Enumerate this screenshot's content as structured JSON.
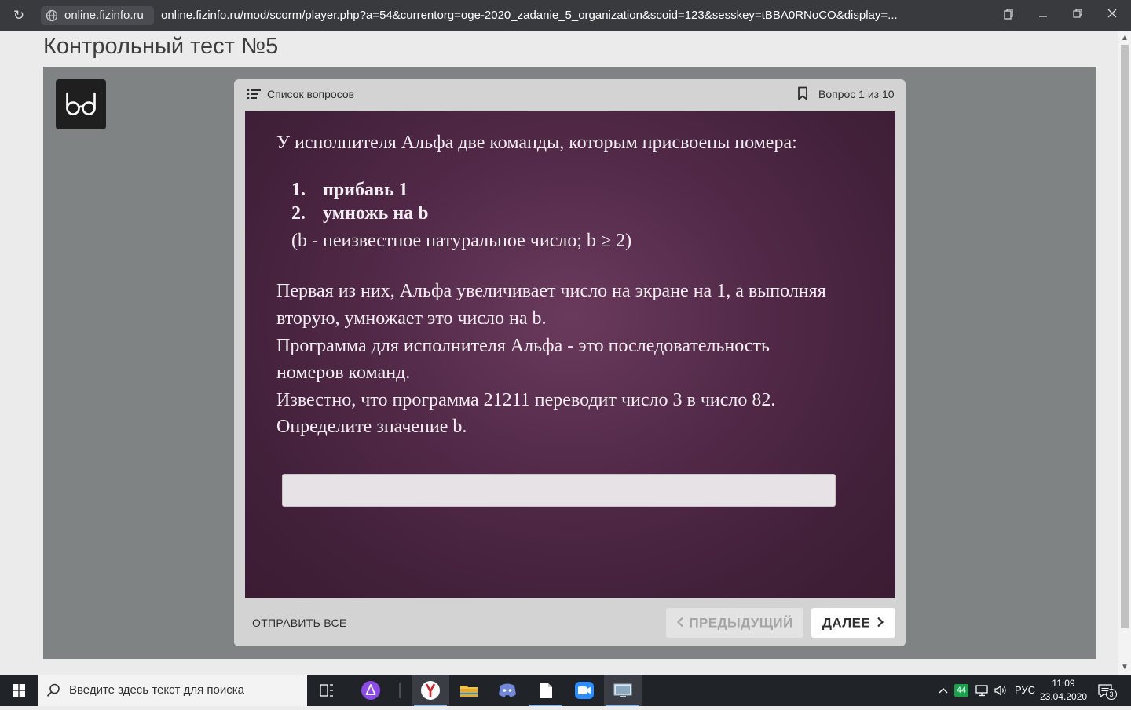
{
  "browser": {
    "domain": "online.fizinfo.ru",
    "url": "online.fizinfo.ru/mod/scorm/player.php?a=54&currentorg=oge-2020_zadanie_5_organization&scoid=123&sesskey=tBBA0RNoCO&display=..."
  },
  "page": {
    "title": "Контрольный тест №5"
  },
  "player": {
    "question_list_label": "Список вопросов",
    "question_counter": "Вопрос 1 из 10",
    "submit_all_label": "ОТПРАВИТЬ ВСЕ",
    "prev_label": "ПРЕДЫДУЩИЙ",
    "next_label": "ДАЛЕЕ"
  },
  "question": {
    "intro": "У исполнителя Альфа две команды, которым присвоены номера:",
    "commands": [
      {
        "num": "1.",
        "text": "прибавь 1"
      },
      {
        "num": "2.",
        "text": "умножь на b"
      }
    ],
    "note": "(b - неизвестное натуральное число; b ≥ 2)",
    "body_lines": [
      "Первая из них, Альфа увеличивает число на экране на 1, а выполняя",
      "вторую, умножает это число на b.",
      "Программа для исполнителя Альфа - это последовательность",
      "номеров команд.",
      "Известно, что программа 21211 переводит число 3 в число 82.",
      "Определите значение b."
    ],
    "answer_value": ""
  },
  "taskbar": {
    "search_placeholder": "Введите здесь текст для поиска",
    "tray_badge": "44",
    "language": "РУС",
    "time": "11:09",
    "date": "23.04.2020",
    "notification_count": "3"
  }
}
